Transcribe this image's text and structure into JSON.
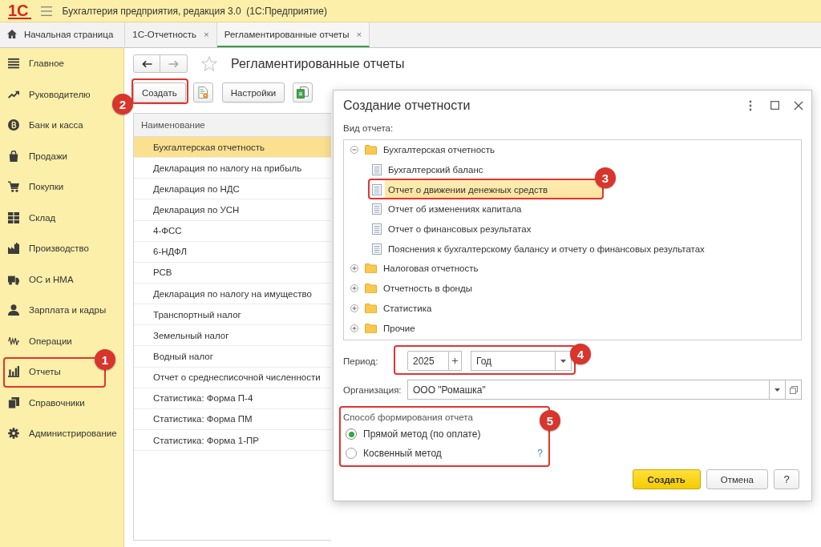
{
  "app": {
    "logo": "1С",
    "title": "Бухгалтерия предприятия, редакция 3.0  (1С:Предприятие)"
  },
  "tabs": [
    {
      "kind": "home",
      "label": "Начальная страница",
      "selected": false
    },
    {
      "kind": "page",
      "label": "1С-Отчетность",
      "close": "×",
      "selected": false
    },
    {
      "kind": "page",
      "label": "Регламентированные отчеты",
      "close": "×",
      "selected": true
    }
  ],
  "sidebar": {
    "items": [
      {
        "label": "Главное"
      },
      {
        "label": "Руководителю"
      },
      {
        "label": "Банк и касса"
      },
      {
        "label": "Продажи"
      },
      {
        "label": "Покупки"
      },
      {
        "label": "Склад"
      },
      {
        "label": "Производство"
      },
      {
        "label": "ОС и НМА"
      },
      {
        "label": "Зарплата и кадры"
      },
      {
        "label": "Операции"
      },
      {
        "label": "Отчеты",
        "callout": "1"
      },
      {
        "label": "Справочники"
      },
      {
        "label": "Администрирование"
      }
    ]
  },
  "page": {
    "navigation": {
      "back": {
        "disabled": false
      },
      "forward": {
        "disabled": true
      }
    },
    "title": "Регламентированные отчеты",
    "toolbar": {
      "create_button": {
        "label": "Создать",
        "callout": "2"
      },
      "settings_button": {
        "label": "Настройки"
      }
    },
    "table": {
      "columns": [
        "Наименование"
      ],
      "rows": [
        {
          "cells": [
            "Бухгалтерская отчетность"
          ],
          "selected": true
        },
        {
          "cells": [
            "Декларация по налогу на прибыль"
          ],
          "selected": false
        },
        {
          "cells": [
            "Декларация по НДС"
          ],
          "selected": false
        },
        {
          "cells": [
            "Декларация по УСН"
          ],
          "selected": false
        },
        {
          "cells": [
            "4-ФСС"
          ],
          "selected": false
        },
        {
          "cells": [
            "6-НДФЛ"
          ],
          "selected": false
        },
        {
          "cells": [
            "РСВ"
          ],
          "selected": false
        },
        {
          "cells": [
            "Декларация по налогу на имущество"
          ],
          "selected": false
        },
        {
          "cells": [
            "Транспортный налог"
          ],
          "selected": false
        },
        {
          "cells": [
            "Земельный налог"
          ],
          "selected": false
        },
        {
          "cells": [
            "Водный налог"
          ],
          "selected": false
        },
        {
          "cells": [
            "Отчет о среднесписочной численности"
          ],
          "selected": false
        },
        {
          "cells": [
            "Статистика: Форма П-4"
          ],
          "selected": false
        },
        {
          "cells": [
            "Статистика: Форма ПМ"
          ],
          "selected": false
        },
        {
          "cells": [
            "Статистика: Форма 1-ПР"
          ],
          "selected": false
        }
      ]
    }
  },
  "dialog": {
    "title": "Создание отчетности",
    "tree_label": "Вид отчета:",
    "tree": [
      {
        "label": "Бухгалтерская отчетность",
        "expanded": true,
        "selected": false,
        "children": [
          {
            "label": "Бухгалтерский баланс",
            "selected": false
          },
          {
            "label": "Отчет о движении денежных средств",
            "selected": true,
            "callout": "3"
          },
          {
            "label": "Отчет об изменениях капитала",
            "selected": false
          },
          {
            "label": "Отчет о финансовых результатах",
            "selected": false
          },
          {
            "label": "Пояснения к бухгалтерскому балансу и отчету о финансовых результатах",
            "selected": false
          }
        ]
      },
      {
        "label": "Налоговая отчетность",
        "expanded": false,
        "selected": false
      },
      {
        "label": "Отчетность в фонды",
        "expanded": false,
        "selected": false
      },
      {
        "label": "Статистика",
        "expanded": false,
        "selected": false
      },
      {
        "label": "Прочие",
        "expanded": false,
        "selected": false
      }
    ],
    "period": {
      "label": "Период:",
      "year": "2025",
      "unit": "Год",
      "callout": "4"
    },
    "organization": {
      "label": "Организация:",
      "value": "ООО \"Ромашка\""
    },
    "method": {
      "title": "Способ формирования отчета",
      "options": [
        {
          "label": "Прямой метод (по оплате)",
          "selected": true
        },
        {
          "label": "Косвенный метод",
          "selected": false
        }
      ],
      "help": "?",
      "callout": "5"
    },
    "buttons": [
      {
        "label": "Создать",
        "kind": "primary"
      },
      {
        "label": "Отмена",
        "kind": "default"
      },
      {
        "label": "?",
        "kind": "help"
      }
    ]
  }
}
